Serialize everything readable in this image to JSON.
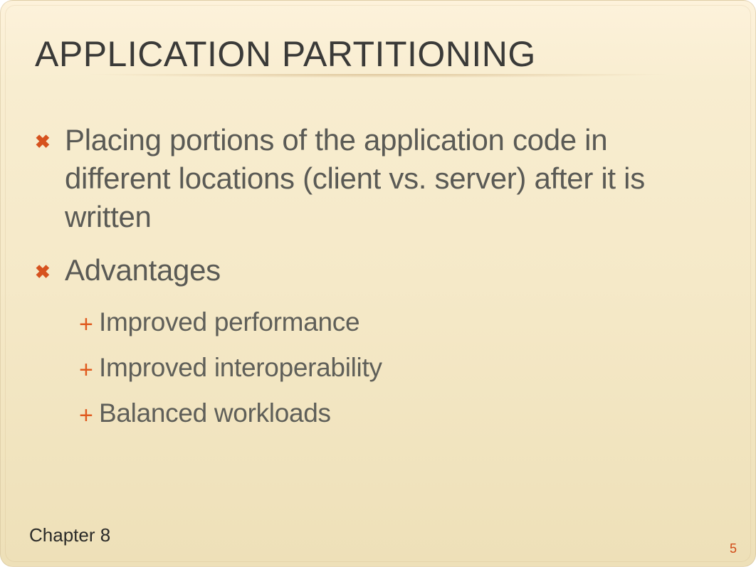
{
  "title": "APPLICATION PARTITIONING",
  "bullets": [
    {
      "text": "Placing portions of the application code in different locations (client vs. server) after it is written",
      "sub": []
    },
    {
      "text": "Advantages",
      "sub": [
        "Improved performance",
        "Improved interoperability",
        "Balanced workloads"
      ]
    }
  ],
  "chapter": "Chapter 8",
  "page_number": "5",
  "bullet_markers": {
    "level1": "✖",
    "level2": "+"
  }
}
